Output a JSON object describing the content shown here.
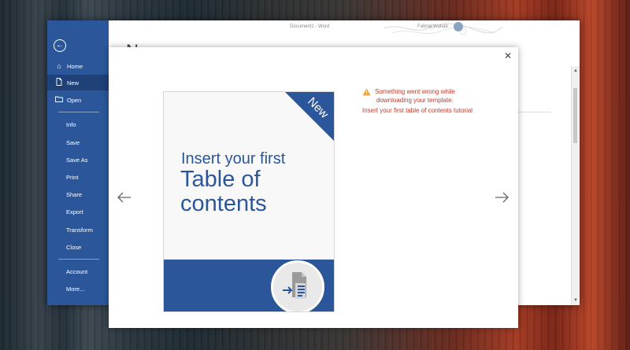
{
  "window": {
    "title": "Document1 - Word",
    "user": "Fatima Wahab"
  },
  "sidebar": {
    "items": [
      {
        "label": "Home",
        "icon": "home-icon"
      },
      {
        "label": "New",
        "icon": "new-document-icon"
      },
      {
        "label": "Open",
        "icon": "folder-icon"
      },
      {
        "label": "Info"
      },
      {
        "label": "Save"
      },
      {
        "label": "Save As"
      },
      {
        "label": "Print"
      },
      {
        "label": "Share"
      },
      {
        "label": "Export"
      },
      {
        "label": "Transform"
      },
      {
        "label": "Close"
      },
      {
        "label": "Account"
      },
      {
        "label": "More..."
      }
    ],
    "active": "New"
  },
  "page": {
    "heading": "New"
  },
  "dialog": {
    "template": {
      "ribbon": "New",
      "title_small": "Insert your first",
      "title_large": "Table of contents"
    },
    "error": {
      "line1": "Something went wrong while",
      "line2": "downloading your template.",
      "template_name": "Insert your first table of contents tutorial"
    }
  },
  "colors": {
    "brand": "#2b579a",
    "error": "#c0392b",
    "warning": "#e8a33c"
  }
}
